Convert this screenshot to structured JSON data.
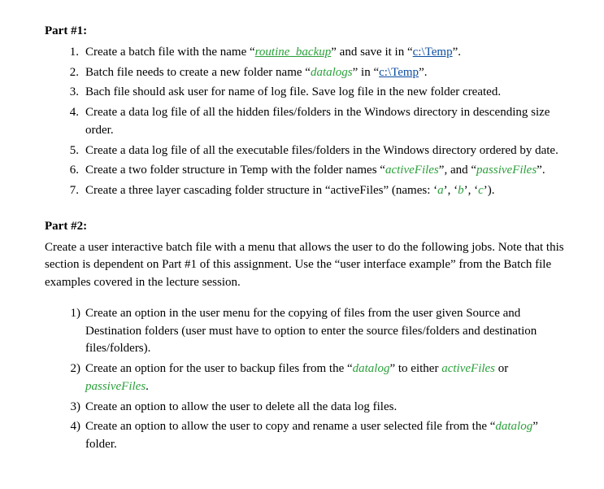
{
  "part1": {
    "heading": "Part #1:",
    "items": [
      {
        "num": "1.",
        "pre": "Create a batch file with the name “",
        "em": "routine_backup",
        "mid": "” and save it in “",
        "link": "c:\\Temp",
        "post": "”."
      },
      {
        "num": "2.",
        "pre": "Batch file needs to create a new folder name “",
        "em": "datalogs",
        "mid": "” in “",
        "link": "c:\\Temp",
        "post": "”."
      },
      {
        "num": "3.",
        "text": "Bach file should ask user for name of log file. Save log file in the new folder created."
      },
      {
        "num": "4.",
        "text": "Create a data log file of all the hidden files/folders in the Windows directory in descending size order."
      },
      {
        "num": "5.",
        "text": "Create a data log file of all the executable files/folders in the Windows directory ordered by date."
      },
      {
        "num": "6.",
        "pre": "Create a two folder structure in Temp with the folder names “",
        "em": "activeFiles",
        "mid": "”, and “",
        "em2": "passiveFiles",
        "post": "”."
      },
      {
        "num": "7.",
        "pre": "Create a three layer cascading folder structure in “activeFiles” (names: ‘",
        "em": "a",
        "mid": "’, ‘",
        "em2": "b",
        "mid2": "’, ‘",
        "em3": "c",
        "post": "’)."
      }
    ]
  },
  "part2": {
    "heading": "Part #2:",
    "intro": "Create a user interactive batch file with a menu that allows the user to do the following jobs. Note that this section is dependent on Part #1 of this assignment. Use the “user interface example” from the Batch file examples covered in the lecture session.",
    "items": [
      {
        "num": "1)",
        "text": "Create an option in the user menu for the copying of files from the user given Source and Destination folders (user must have to option to enter the source files/folders and destination files/folders)."
      },
      {
        "num": "2)",
        "pre": "Create an option for the user to backup files from the “",
        "em": "datalog",
        "mid": "” to either ",
        "em2": "activeFiles",
        "mid2": " or ",
        "em3": "passiveFiles",
        "post": "."
      },
      {
        "num": "3)",
        "text": "Create an option to allow the user to delete all the data log files."
      },
      {
        "num": "4)",
        "pre": "Create an option to allow the user to copy and rename a user selected file from the “",
        "em": "datalog",
        "post": "” folder."
      }
    ]
  }
}
